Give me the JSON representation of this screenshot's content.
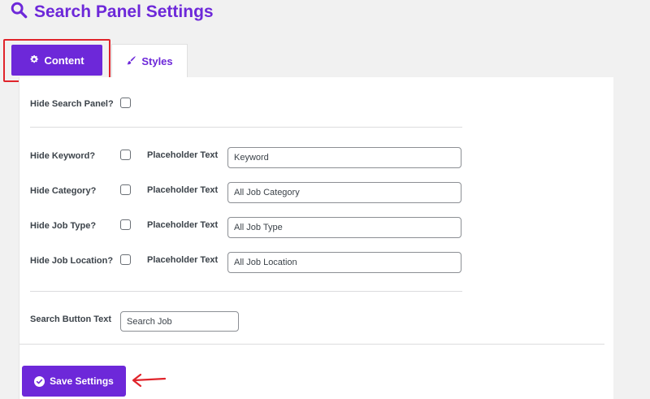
{
  "header": {
    "title": "Search Panel Settings",
    "icon": "search-icon"
  },
  "tabs": [
    {
      "label": "Content",
      "icon": "gear-icon",
      "active": true
    },
    {
      "label": "Styles",
      "icon": "brush-icon",
      "active": false
    }
  ],
  "form": {
    "hide_panel_label": "Hide Search Panel?",
    "hide_panel_checked": false,
    "fields": [
      {
        "hide_label": "Hide Keyword?",
        "checked": false,
        "placeholder_label": "Placeholder Text",
        "value": "Keyword"
      },
      {
        "hide_label": "Hide Category?",
        "checked": false,
        "placeholder_label": "Placeholder Text",
        "value": "All Job Category"
      },
      {
        "hide_label": "Hide Job Type?",
        "checked": false,
        "placeholder_label": "Placeholder Text",
        "value": "All Job Type"
      },
      {
        "hide_label": "Hide Job Location?",
        "checked": false,
        "placeholder_label": "Placeholder Text",
        "value": "All Job Location"
      }
    ],
    "search_button_label": "Search Button Text",
    "search_button_value": "Search Job"
  },
  "actions": {
    "save_label": "Save Settings",
    "save_icon": "check-circle-icon"
  },
  "colors": {
    "accent": "#6d28d9",
    "annotation": "#e0242b"
  }
}
